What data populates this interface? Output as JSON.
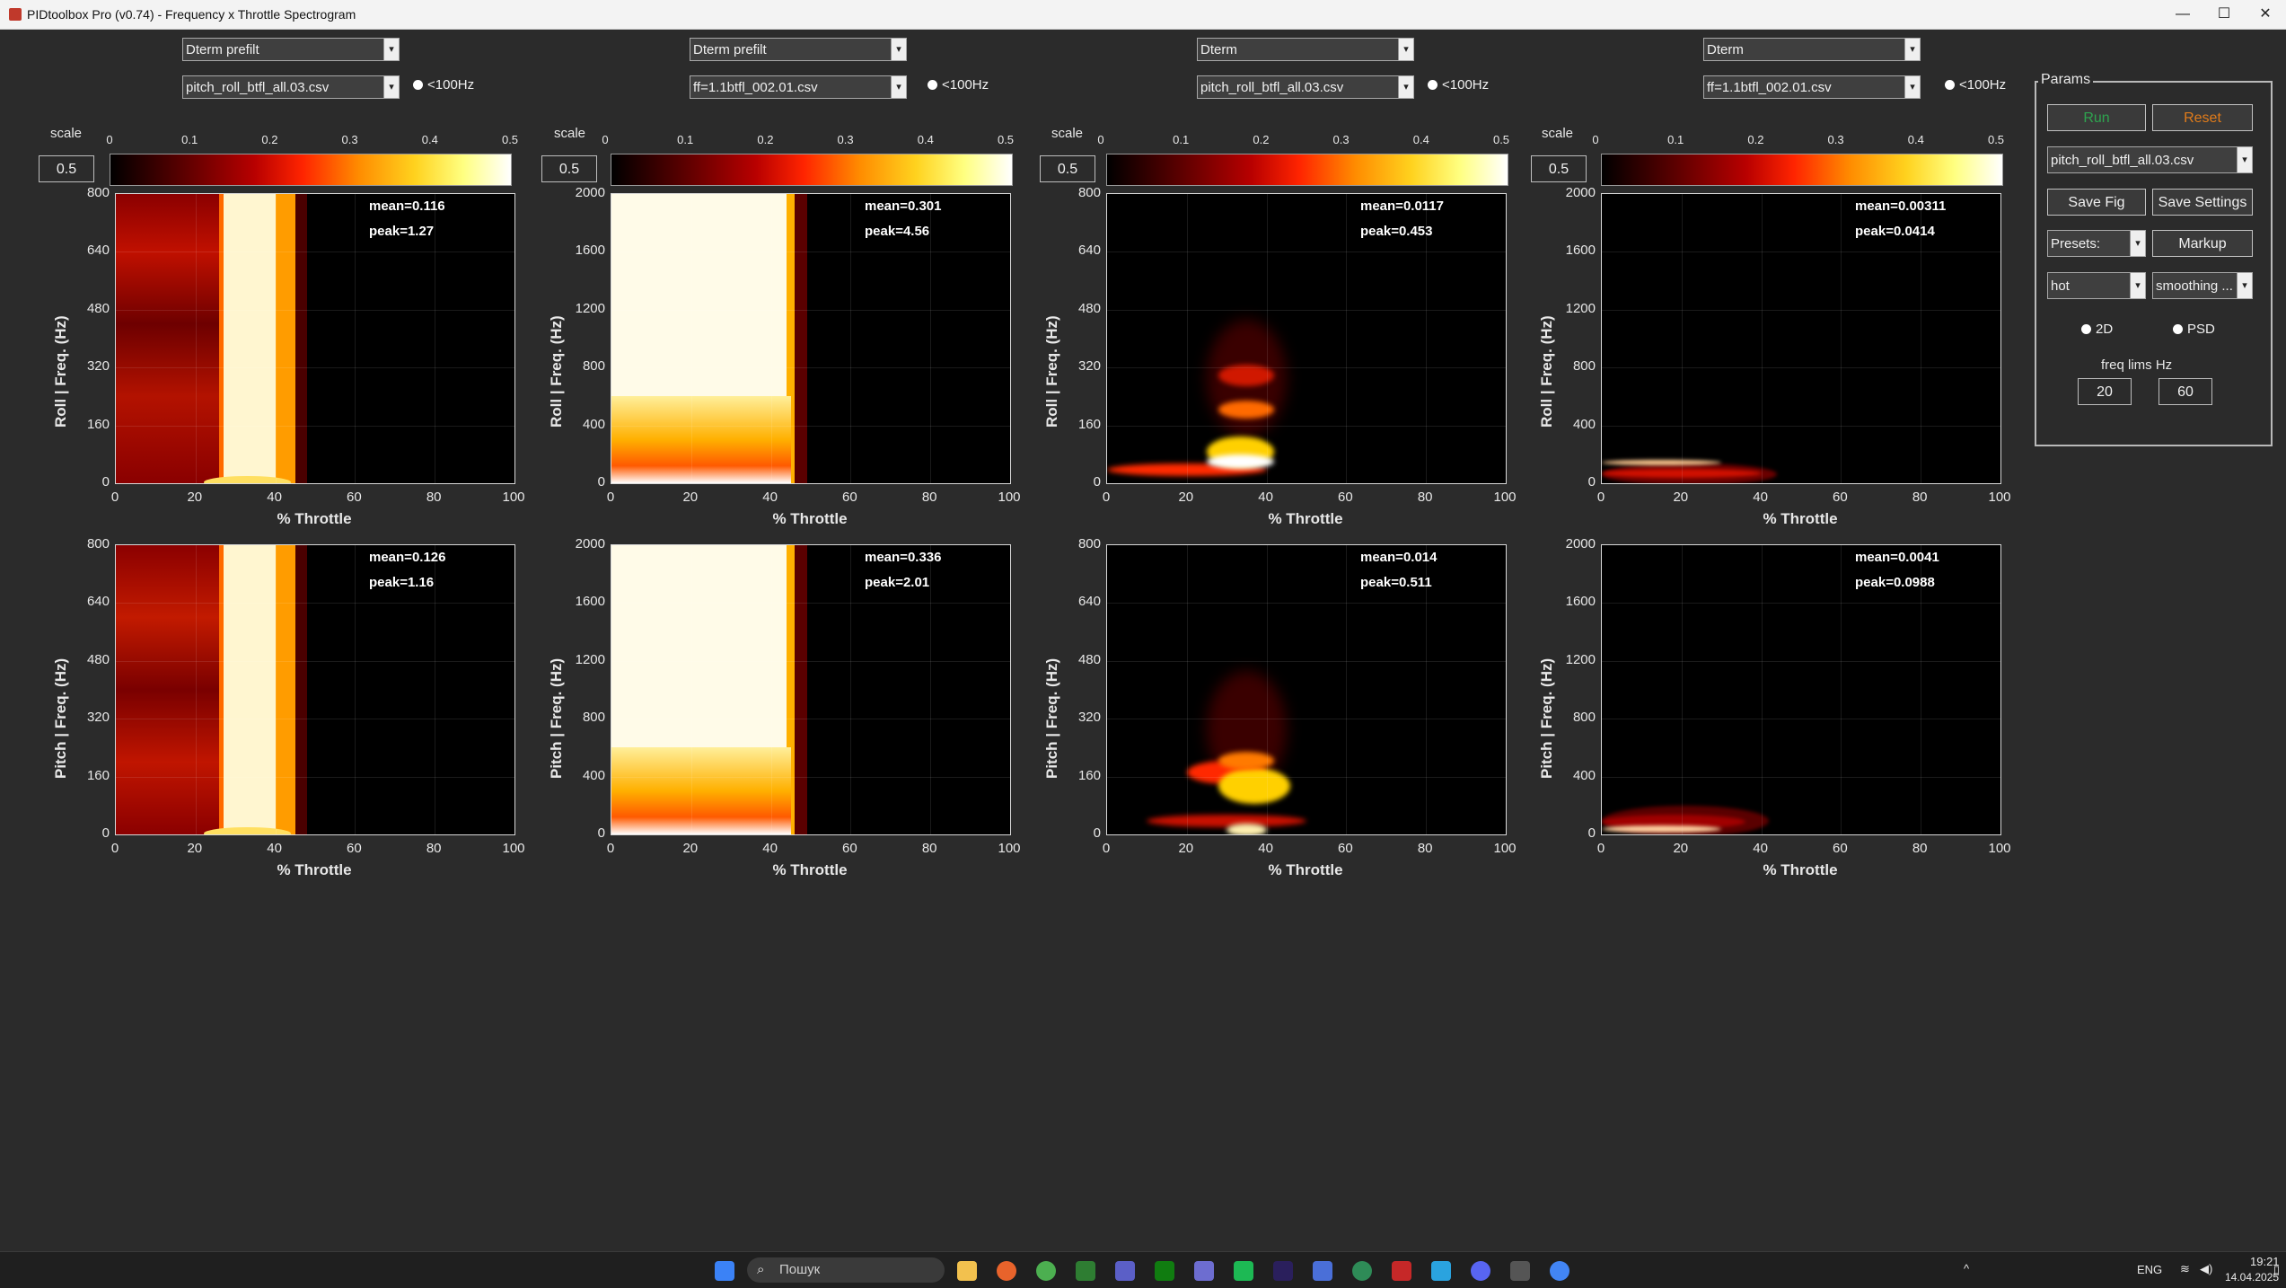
{
  "window": {
    "title": "PIDtoolbox Pro (v0.74) - Frequency x Throttle Spectrogram",
    "min": "—",
    "max": "☐",
    "close": "✕"
  },
  "columns": [
    {
      "signal": "Dterm prefilt",
      "file": "pitch_roll_btfl_all.03.csv",
      "lt100": "<100Hz",
      "scale_label": "scale",
      "scale": "0.5"
    },
    {
      "signal": "Dterm prefilt",
      "file": "ff=1.1btfl_002.01.csv",
      "lt100": "<100Hz",
      "scale_label": "scale",
      "scale": "0.5"
    },
    {
      "signal": "Dterm",
      "file": "pitch_roll_btfl_all.03.csv",
      "lt100": "<100Hz",
      "scale_label": "scale",
      "scale": "0.5"
    },
    {
      "signal": "Dterm",
      "file": "ff=1.1btfl_002.01.csv",
      "lt100": "<100Hz",
      "scale_label": "scale",
      "scale": "0.5"
    }
  ],
  "colorbar_ticks": [
    "0",
    "0.1",
    "0.2",
    "0.3",
    "0.4",
    "0.5"
  ],
  "rows": [
    {
      "axis": "Roll",
      "ylabel": "Roll  |  Freq. (Hz)"
    },
    {
      "axis": "Pitch",
      "ylabel": "Pitch  |  Freq. (Hz)"
    }
  ],
  "xlabel": "% Throttle",
  "xticks": [
    "0",
    "20",
    "40",
    "60",
    "80",
    "100"
  ],
  "yticks_800": [
    "800",
    "640",
    "480",
    "320",
    "160",
    "0"
  ],
  "yticks_2000": [
    "2000",
    "1600",
    "1200",
    "800",
    "400",
    "0"
  ],
  "stats": [
    {
      "mean": "mean=0.116",
      "peak": "peak=1.27"
    },
    {
      "mean": "mean=0.301",
      "peak": "peak=4.56"
    },
    {
      "mean": "mean=0.0117",
      "peak": "peak=0.453"
    },
    {
      "mean": "mean=0.00311",
      "peak": "peak=0.0414"
    },
    {
      "mean": "mean=0.126",
      "peak": "peak=1.16"
    },
    {
      "mean": "mean=0.336",
      "peak": "peak=2.01"
    },
    {
      "mean": "mean=0.014",
      "peak": "peak=0.511"
    },
    {
      "mean": "mean=0.0041",
      "peak": "peak=0.0988"
    }
  ],
  "params": {
    "legend": "Params",
    "run": "Run",
    "reset": "Reset",
    "file": "pitch_roll_btfl_all.03.csv",
    "save_fig": "Save Fig",
    "save_settings": "Save Settings",
    "presets": "Presets:",
    "markup": "Markup",
    "colormap": "hot",
    "smoothing": "smoothing ...",
    "mode_2d": "2D",
    "mode_psd": "PSD",
    "freq_lims_label": "freq lims Hz",
    "freq_min": "20",
    "freq_max": "60",
    "run_color": "#2ea44f",
    "reset_color": "#e07b1a"
  },
  "taskbar": {
    "search_placeholder": "Пошук",
    "lang": "ENG",
    "time": "19:21",
    "date": "14.04.2025"
  }
}
